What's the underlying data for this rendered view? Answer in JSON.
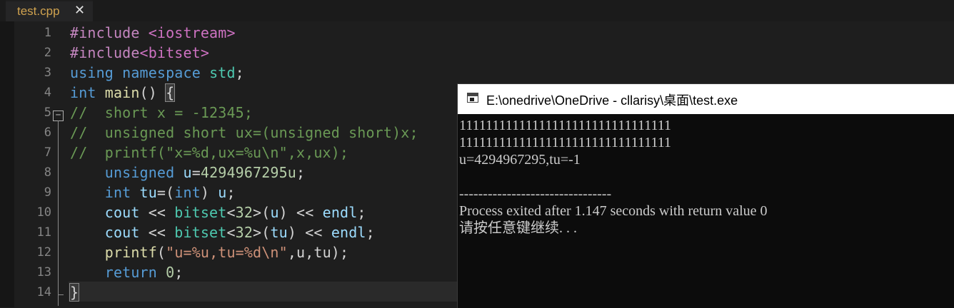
{
  "tab": {
    "label": "test.cpp",
    "close": "✕"
  },
  "gutter": [
    "1",
    "2",
    "3",
    "4",
    "5",
    "6",
    "7",
    "8",
    "9",
    "10",
    "11",
    "12",
    "13",
    "14"
  ],
  "fold_icon": "−",
  "code": {
    "l1": {
      "directive": "#include",
      "header": " <iostream>"
    },
    "l2": {
      "directive": "#include",
      "header": "<bitset>"
    },
    "l3": {
      "kw1": "using",
      "kw2": " namespace",
      "ns": " std",
      "semi": ";"
    },
    "l4": {
      "type": "int",
      "name": " main",
      "parens": "() ",
      "brace": "{"
    },
    "l5": "//  short x = -12345;",
    "l6": "//  unsigned short ux=(unsigned short)x;",
    "l7": "//  printf(\"x=%d,ux=%u\\n\",x,ux);",
    "l8": {
      "indent": "    ",
      "type": "unsigned",
      "var": " u",
      "eq": "=",
      "num": "4294967295u",
      "semi": ";"
    },
    "l9": {
      "indent": "    ",
      "type": "int",
      "var": " tu",
      "open": "=(",
      "cast": "int",
      "close": ") ",
      "arg": "u",
      "semi": ";"
    },
    "l10": {
      "indent": "    ",
      "cout": "cout",
      "op1": " << ",
      "bitset": "bitset",
      "tmpl_open": "<",
      "n": "32",
      "tmpl_close": ">",
      "arg_open": "(",
      "arg": "u",
      "arg_close": ")",
      "op2": " << ",
      "endl": "endl",
      "semi": ";"
    },
    "l11": {
      "indent": "    ",
      "cout": "cout",
      "op1": " << ",
      "bitset": "bitset",
      "tmpl_open": "<",
      "n": "32",
      "tmpl_close": ">",
      "arg_open": "(",
      "arg": "tu",
      "arg_close": ")",
      "op2": " << ",
      "endl": "endl",
      "semi": ";"
    },
    "l12": {
      "indent": "    ",
      "fn": "printf",
      "open": "(",
      "str": "\"u=%u,tu=%d\\n\"",
      "args": ",u,tu",
      "close": ");"
    },
    "l13": {
      "indent": "    ",
      "kw": "return",
      "num": " 0",
      "semi": ";"
    },
    "l14": {
      "brace": "}"
    }
  },
  "console": {
    "title": "E:\\onedrive\\OneDrive - cllarisy\\桌面\\test.exe",
    "lines": [
      "11111111111111111111111111111111",
      "11111111111111111111111111111111",
      "u=4294967295,tu=-1",
      "",
      "--------------------------------",
      "Process exited after 1.147 seconds with return value 0",
      "请按任意键继续. . ."
    ]
  },
  "colors": {
    "editor_bg": "#1e1e1e",
    "tab_text": "#cfa24f",
    "keyword": "#569cd6",
    "preprocessor": "#c586c0",
    "comment": "#6a9955",
    "function": "#dcdcaa",
    "number": "#b5cea8",
    "string": "#ce9178",
    "console_bg": "#0c0c0c",
    "console_text": "#cccccc"
  }
}
